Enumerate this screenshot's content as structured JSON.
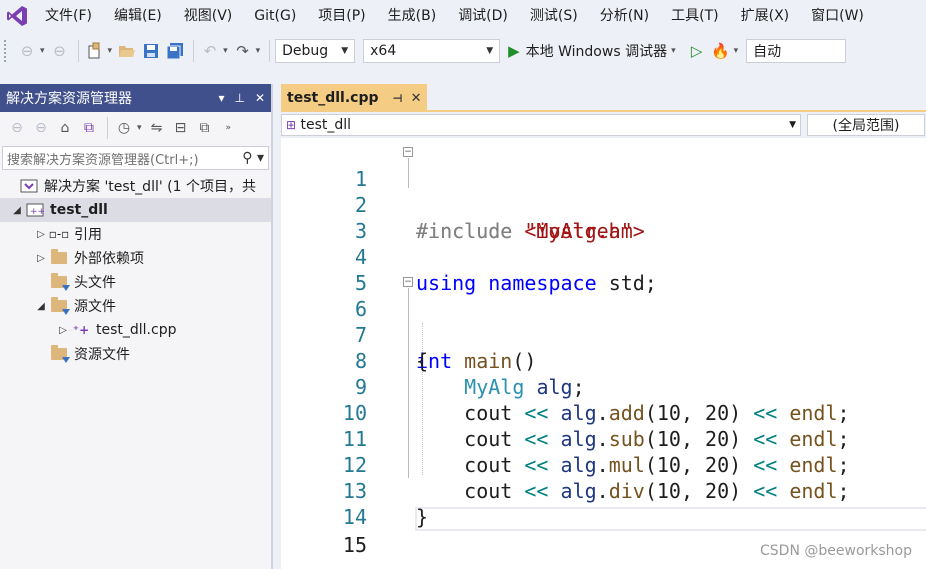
{
  "menu": [
    "文件(F)",
    "编辑(E)",
    "视图(V)",
    "Git(G)",
    "项目(P)",
    "生成(B)",
    "调试(D)",
    "测试(S)",
    "分析(N)",
    "工具(T)",
    "扩展(X)",
    "窗口(W)"
  ],
  "toolbar": {
    "config": "Debug",
    "platform": "x64",
    "run_label": "本地 Windows 调试器",
    "auto": "自动"
  },
  "solution_explorer": {
    "title": "解决方案资源管理器",
    "search_placeholder": "搜索解决方案资源管理器(Ctrl+;)",
    "tree": [
      {
        "label": "解决方案 'test_dll' (1 个项目，共",
        "expander": ""
      },
      {
        "label": "test_dll",
        "expander": "◢"
      },
      {
        "label": "引用",
        "expander": "▷"
      },
      {
        "label": "外部依赖项",
        "expander": "▷"
      },
      {
        "label": "头文件",
        "expander": ""
      },
      {
        "label": "源文件",
        "expander": "◢"
      },
      {
        "label": "test_dll.cpp",
        "expander": "▷"
      },
      {
        "label": "资源文件",
        "expander": ""
      }
    ]
  },
  "editor": {
    "tab": "test_dll.cpp",
    "scope": "test_dll",
    "global_scope": "(全局范围)",
    "line_numbers": [
      "1",
      "2",
      "3",
      "4",
      "5",
      "6",
      "7",
      "8",
      "9",
      "10",
      "11",
      "12",
      "13",
      "14",
      "15"
    ],
    "code": {
      "l1_kw": "#include",
      "l1_hdr": "<iostream>",
      "l2_kw": "#include",
      "l2_hdr": "\"MyAlg.h\"",
      "l4_using": "using",
      "l4_ns": "namespace",
      "l4_std": "std;",
      "l6_int": "int",
      "l6_main": "main",
      "l6_paren": "()",
      "l7": "{",
      "l8_type": "MyAlg",
      "l8_var": "alg",
      "l8_semi": ";",
      "cout": "cout",
      "op": "<<",
      "alg": "alg",
      "dot": ".",
      "endl": "endl",
      "semi": ";",
      "args": "(10, 20)",
      "methods": [
        "add",
        "sub",
        "mul",
        "div"
      ],
      "l13": "}"
    }
  },
  "watermark": "CSDN @beeworkshop"
}
